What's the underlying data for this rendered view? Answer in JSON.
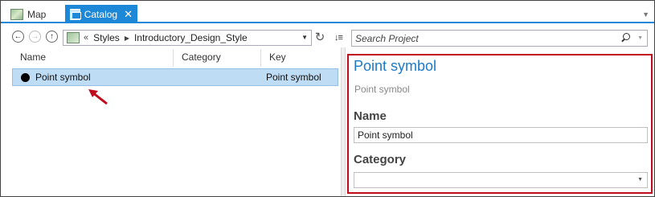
{
  "tabs": [
    {
      "label": "Map",
      "icon": "map-icon"
    },
    {
      "label": "Catalog",
      "icon": "catalog-icon",
      "active": true,
      "close": "✕"
    }
  ],
  "toolbar": {
    "path": {
      "overflow": "«",
      "segments": [
        "Styles",
        "Introductory_Design_Style"
      ]
    },
    "search": {
      "placeholder": "Search Project"
    }
  },
  "table": {
    "columns": [
      "Name",
      "Category",
      "Key"
    ],
    "rows": [
      {
        "name": "Point symbol",
        "category": "",
        "key": "Point symbol",
        "selected": true
      }
    ]
  },
  "details": {
    "title": "Point symbol",
    "subtitle": "Point symbol",
    "name_label": "Name",
    "name_value": "Point symbol",
    "category_label": "Category",
    "category_value": ""
  },
  "colors": {
    "accent": "#1e88d8",
    "selection": "#bfdcf5",
    "highlight_border": "#c00d1e",
    "title": "#1b7ac8"
  }
}
